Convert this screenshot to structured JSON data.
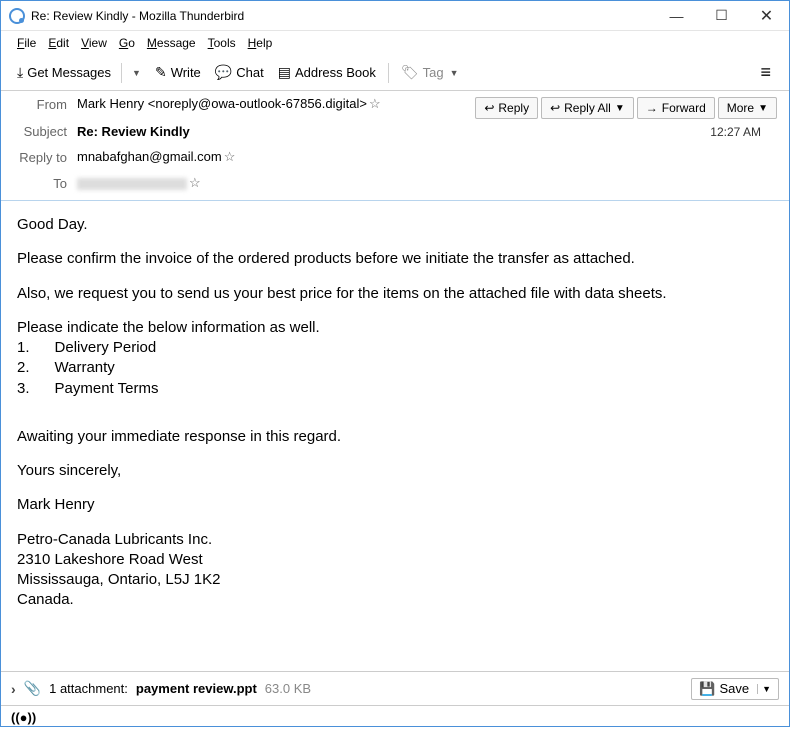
{
  "window": {
    "title": "Re: Review Kindly - Mozilla Thunderbird"
  },
  "menu": {
    "file": "File",
    "edit": "Edit",
    "view": "View",
    "go": "Go",
    "message": "Message",
    "tools": "Tools",
    "help": "Help"
  },
  "toolbar": {
    "getmsg": "Get Messages",
    "write": "Write",
    "chat": "Chat",
    "addr": "Address Book",
    "tag": "Tag"
  },
  "actions": {
    "reply": "Reply",
    "replyall": "Reply All",
    "forward": "Forward",
    "more": "More"
  },
  "headers": {
    "from_label": "From",
    "from": "Mark Henry <noreply@owa-outlook-67856.digital>",
    "subject_label": "Subject",
    "subject": "Re: Review Kindly",
    "replyto_label": "Reply to",
    "replyto": "mnabafghan@gmail.com",
    "to_label": "To",
    "time": "12:27 AM"
  },
  "body": {
    "l1": "Good Day.",
    "l2": "Please confirm the invoice of the ordered products before we initiate the transfer as attached.",
    "l3": "Also, we request you to send us your best price for the items on the attached file with data sheets.",
    "l4": "Please indicate the below information as well.",
    "li1": "1.      Delivery Period",
    "li2": "2.      Warranty",
    "li3": "3.      Payment Terms",
    "l5": "Awaiting your immediate response in this regard.",
    "l6": "Yours sincerely,",
    "l7": "Mark Henry",
    "a1": "Petro-Canada Lubricants Inc.",
    "a2": "2310 Lakeshore Road West",
    "a3": "Mississauga, Ontario, L5J 1K2",
    "a4": "Canada."
  },
  "attach": {
    "count": "1 attachment:",
    "name": "payment review.ppt",
    "size": "63.0 KB",
    "save": "Save"
  }
}
